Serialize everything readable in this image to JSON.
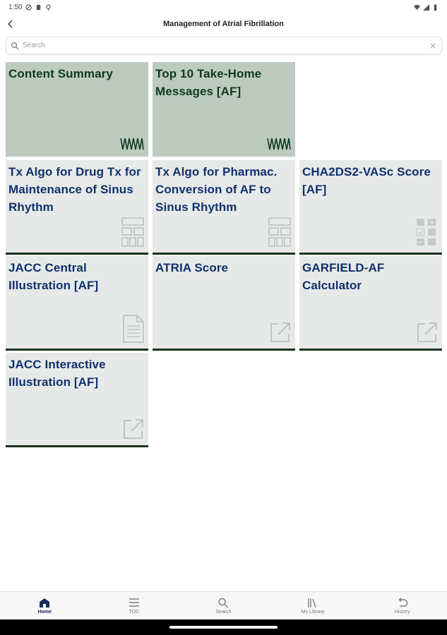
{
  "status": {
    "time": "1:50"
  },
  "header": {
    "title": "Management of Atrial Fibrillation"
  },
  "search": {
    "placeholder": "Search"
  },
  "tiles": [
    {
      "label": "Content Summary",
      "icon": "waveform-icon"
    },
    {
      "label": "Top 10 Take-Home Messages [AF]",
      "icon": "waveform-icon"
    },
    {
      "label": "Tx Algo for Drug Tx for Maintenance of Sinus Rhythm",
      "icon": "algorithm-icon"
    },
    {
      "label": "Tx Algo for Pharmac. Conversion of AF to Sinus Rhythm",
      "icon": "algorithm-icon"
    },
    {
      "label": "CHA2DS2-VASc Score [AF]",
      "icon": "checklist-icon"
    },
    {
      "label": "JACC Central Illustration [AF]",
      "icon": "document-icon"
    },
    {
      "label": "ATRIA Score",
      "icon": "external-link-icon"
    },
    {
      "label": "GARFIELD-AF Calculator",
      "icon": "external-link-icon"
    },
    {
      "label": "JACC Interactive Illustration [AF]",
      "icon": "external-link-icon"
    }
  ],
  "nav": [
    {
      "label": "Home",
      "icon": "home-icon"
    },
    {
      "label": "TOC",
      "icon": "menu-icon"
    },
    {
      "label": "Search",
      "icon": "search-icon"
    },
    {
      "label": "My Library",
      "icon": "library-icon"
    },
    {
      "label": "History",
      "icon": "history-icon"
    }
  ],
  "colors": {
    "tile_light": "#e6e9e8",
    "tile_dark": "#bccac0",
    "tile_text": "#10316d",
    "tile_dark_text": "#0f3a1f",
    "tile_border": "#17331b"
  }
}
